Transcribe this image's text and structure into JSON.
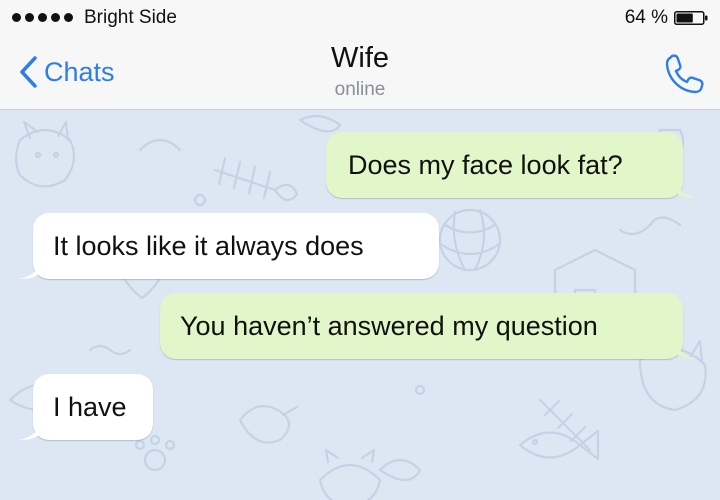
{
  "status_bar": {
    "carrier": "Bright Side",
    "battery_percent": "64 %",
    "battery_level": 0.64,
    "signal_bars": 5
  },
  "nav": {
    "back_label": "Chats",
    "title": "Wife",
    "subtitle": "online",
    "call_icon": "phone-icon",
    "back_icon": "chevron-left-icon"
  },
  "colors": {
    "accent": "#2f7ee6",
    "outgoing_bubble": "#e1f7c9",
    "incoming_bubble": "#ffffff",
    "chat_background": "#dde7f3"
  },
  "messages": [
    {
      "direction": "outgoing",
      "text": "Does my face look fat?"
    },
    {
      "direction": "incoming",
      "text": "It looks like it always does"
    },
    {
      "direction": "outgoing",
      "text": "You haven’t answered my question"
    },
    {
      "direction": "incoming",
      "text": "I have"
    }
  ]
}
